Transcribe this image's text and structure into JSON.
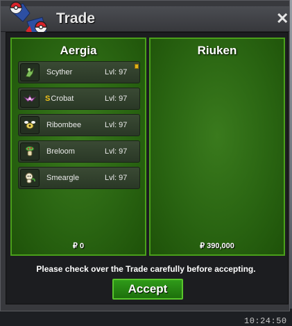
{
  "window": {
    "title": "Trade",
    "close_icon": "close-icon"
  },
  "left_panel": {
    "player": "Aergia",
    "money": "₽ 0",
    "pokemon": [
      {
        "name": "Scyther",
        "level": "Lvl: 97",
        "shiny": false,
        "held_item": true,
        "icon": "scyther-icon"
      },
      {
        "name": "Crobat",
        "level": "Lvl: 97",
        "shiny": true,
        "shiny_mark": "S",
        "held_item": false,
        "icon": "crobat-icon"
      },
      {
        "name": "Ribombee",
        "level": "Lvl: 97",
        "shiny": false,
        "held_item": false,
        "icon": "ribombee-icon"
      },
      {
        "name": "Breloom",
        "level": "Lvl: 97",
        "shiny": false,
        "held_item": false,
        "icon": "breloom-icon"
      },
      {
        "name": "Smeargle",
        "level": "Lvl: 97",
        "shiny": false,
        "held_item": false,
        "icon": "smeargle-icon"
      }
    ]
  },
  "right_panel": {
    "player": "Riuken",
    "money": "₽ 390,000",
    "pokemon": []
  },
  "notice": "Please check over the Trade carefully before accepting.",
  "accept_label": "Accept",
  "clock": "10:24:50",
  "colors": {
    "panel_green": "#2a6512",
    "panel_border": "#4aa01a",
    "accept_green": "#2f9a19",
    "shiny_gold": "#f0c419"
  }
}
